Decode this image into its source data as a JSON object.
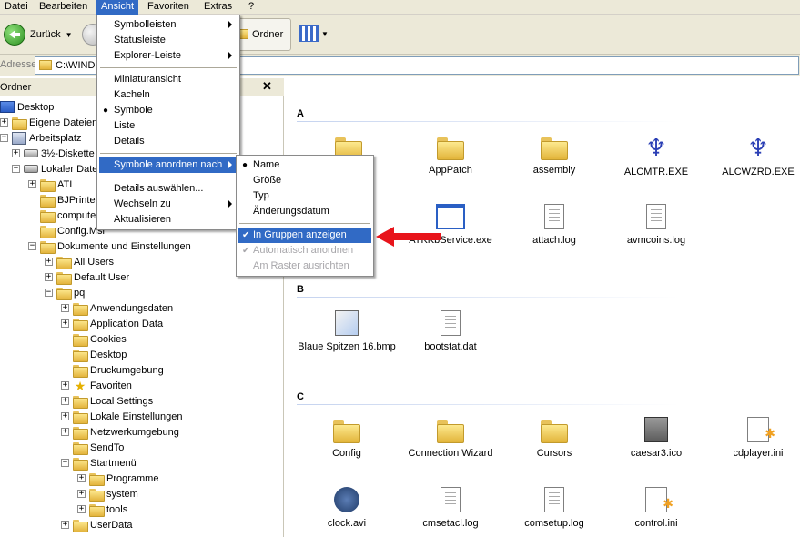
{
  "menubar": {
    "items": [
      "Datei",
      "Bearbeiten",
      "Ansicht",
      "Favoriten",
      "Extras",
      "?"
    ]
  },
  "toolbar": {
    "back_label": "Zurück",
    "folders_label": "Ordner"
  },
  "address": {
    "label": "Adresse",
    "value": "C:\\WIND"
  },
  "folder_pane": {
    "title": "Ordner",
    "close": "✕",
    "items": [
      {
        "label": "Desktop"
      },
      {
        "label": "Eigene Dateien"
      },
      {
        "label": "Arbeitsplatz"
      },
      {
        "label": "3½-Diskette"
      },
      {
        "label": "Lokaler Date"
      },
      {
        "label": "ATI"
      },
      {
        "label": "BJPrinter"
      },
      {
        "label": "compute"
      },
      {
        "label": "Config.Msi"
      },
      {
        "label": "Dokumente und Einstellungen"
      },
      {
        "label": "All Users"
      },
      {
        "label": "Default User"
      },
      {
        "label": "pq"
      },
      {
        "label": "Anwendungsdaten"
      },
      {
        "label": "Application Data"
      },
      {
        "label": "Cookies"
      },
      {
        "label": "Desktop"
      },
      {
        "label": "Druckumgebung"
      },
      {
        "label": "Favoriten"
      },
      {
        "label": "Local Settings"
      },
      {
        "label": "Lokale Einstellungen"
      },
      {
        "label": "Netzwerkumgebung"
      },
      {
        "label": "SendTo"
      },
      {
        "label": "Startmenü"
      },
      {
        "label": "Programme"
      },
      {
        "label": "system"
      },
      {
        "label": "tools"
      },
      {
        "label": "UserData"
      }
    ]
  },
  "content": {
    "groups": [
      {
        "letter": "A",
        "items": [
          "AppPatch",
          "assembly",
          "ALCMTR.EXE",
          "ALCWZRD.EXE",
          "ATKKbService.exe",
          "attach.log",
          "avmcoins.log"
        ]
      },
      {
        "letter": "B",
        "items": [
          "Blaue Spitzen 16.bmp",
          "bootstat.dat"
        ]
      },
      {
        "letter": "C",
        "items": [
          "Config",
          "Connection Wizard",
          "Cursors",
          "caesar3.ico",
          "cdplayer.ini",
          "clock.avi",
          "cmsetacl.log",
          "comsetup.log",
          "control.ini"
        ]
      }
    ]
  },
  "ansicht_menu": {
    "items": [
      "Symbolleisten",
      "Statusleiste",
      "Explorer-Leiste",
      "Miniaturansicht",
      "Kacheln",
      "Symbole",
      "Liste",
      "Details",
      "Symbole anordnen nach",
      "Details auswählen...",
      "Wechseln zu",
      "Aktualisieren"
    ]
  },
  "arrange_menu": {
    "items": [
      "Name",
      "Größe",
      "Typ",
      "Änderungsdatum",
      "In Gruppen anzeigen",
      "Automatisch anordnen",
      "Am Raster ausrichten"
    ]
  },
  "colors": {
    "highlight": "#316ac5",
    "arrow": "#e8141b"
  }
}
